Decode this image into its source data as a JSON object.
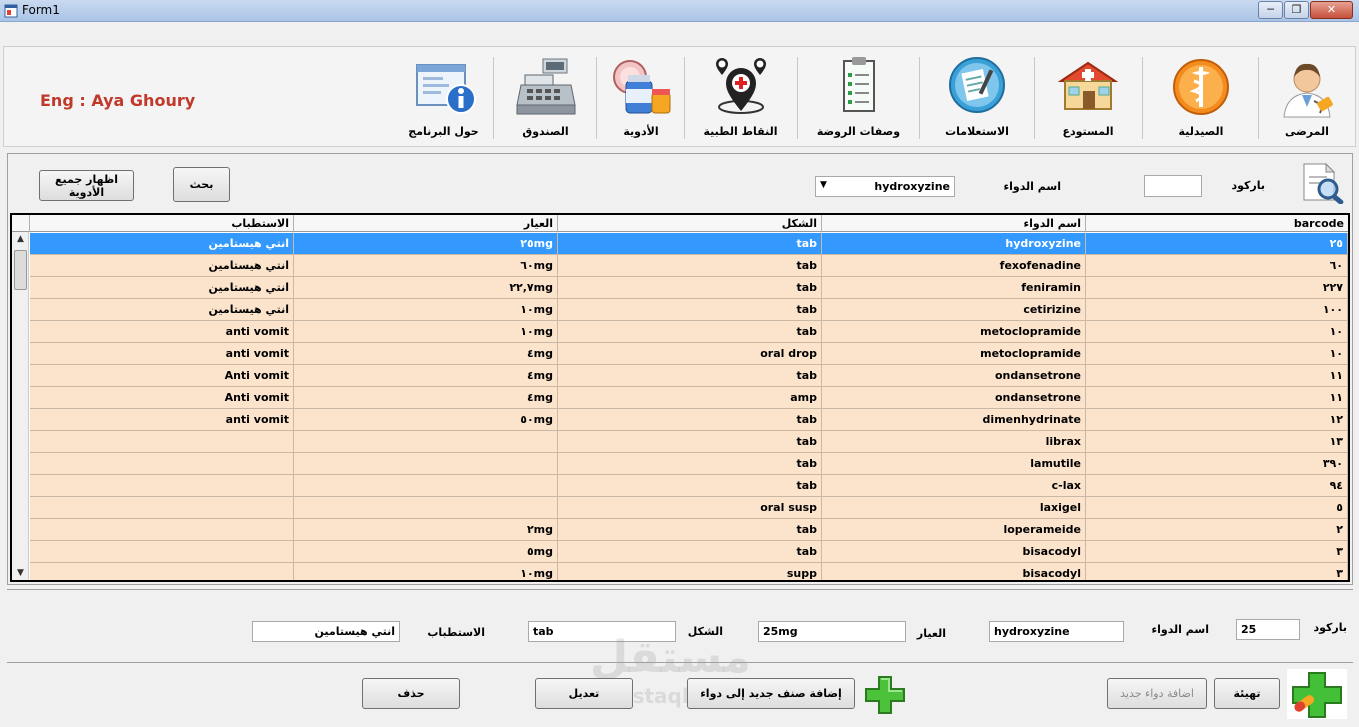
{
  "window": {
    "title": "Form1",
    "minimize": "─",
    "restore": "❐",
    "close": "✕"
  },
  "toolbar": {
    "author": "Eng : Aya Ghoury",
    "items": [
      {
        "label": "المرضى",
        "icon": "doctor-icon"
      },
      {
        "label": "الصيدلية",
        "icon": "pharmacy-caduceus-icon"
      },
      {
        "label": "المستودع",
        "icon": "warehouse-icon"
      },
      {
        "label": "الاستعلامات",
        "icon": "inquiries-icon"
      },
      {
        "label": "وصفات الروضة",
        "icon": "prescription-icon"
      },
      {
        "label": "النقاط الطبية",
        "icon": "medical-points-icon"
      },
      {
        "label": "الأدوية",
        "icon": "medicines-icon"
      },
      {
        "label": "الصندوق",
        "icon": "cash-register-icon"
      },
      {
        "label": "حول البرنامج",
        "icon": "about-info-icon"
      }
    ]
  },
  "search": {
    "barcode_label": "باركود",
    "barcode_value": "",
    "name_label": "اسم الدواء",
    "name_value": "hydroxyzine",
    "search_button": "بحث",
    "show_all_button": "اظهار جميع الأدوية"
  },
  "grid": {
    "columns": [
      "barcode",
      "اسم الدواء",
      "الشكل",
      "العيار",
      "الاستطباب"
    ],
    "rows": [
      [
        "٢٥",
        "hydroxyzine",
        "tab",
        "٢٥mg",
        "انتي هيستامين"
      ],
      [
        "٦٠",
        "fexofenadine",
        "tab",
        "٦٠mg",
        "انتي هيستامين"
      ],
      [
        "٢٢٧",
        "feniramin",
        "tab",
        "٢٢,٧mg",
        "انتي هيستامين"
      ],
      [
        "١٠٠",
        "cetirizine",
        "tab",
        "١٠mg",
        "انتي هيستامين"
      ],
      [
        "١٠",
        "metoclopramide",
        "tab",
        "١٠mg",
        "anti vomit"
      ],
      [
        "١٠",
        "metoclopramide",
        "oral drop",
        "٤mg",
        "anti vomit"
      ],
      [
        "١١",
        "ondansetrone",
        "tab",
        "٤mg",
        "Anti vomit"
      ],
      [
        "١١",
        "ondansetrone",
        "amp",
        "٤mg",
        "Anti vomit"
      ],
      [
        "١٢",
        "dimenhydrinate",
        "tab",
        "٥٠mg",
        "anti vomit"
      ],
      [
        "١٣",
        "librax",
        "tab",
        "",
        ""
      ],
      [
        "٣٩٠",
        "lamutile",
        "tab",
        "",
        ""
      ],
      [
        "٩٤",
        "c-lax",
        "tab",
        "",
        ""
      ],
      [
        "٥",
        "laxigel",
        "oral susp",
        "",
        ""
      ],
      [
        "٢",
        "loperameide",
        "tab",
        "٢mg",
        ""
      ],
      [
        "٣",
        "bisacodyl",
        "tab",
        "٥mg",
        ""
      ],
      [
        "٣",
        "bisacodyl",
        "supp",
        "١٠mg",
        ""
      ]
    ],
    "scroll_up": "▲",
    "scroll_down": "▼"
  },
  "detail": {
    "barcode_label": "باركود",
    "barcode_value": "25",
    "name_label": "اسم الدواء",
    "name_value": "hydroxyzine",
    "dose_label": "العيار",
    "dose_value": "25mg",
    "form_label": "الشكل",
    "form_value": "tab",
    "indication_label": "الاستطباب",
    "indication_value": "انتي هيستامين"
  },
  "actions": {
    "reset": "تهيئة",
    "add_new": "اضافة دواء جديد",
    "add_form": "إضافة صنف جديد إلى دواء",
    "edit": "تعديل",
    "delete": "حذف"
  },
  "watermark": {
    "text": "مستقل",
    "sub": "mostaql.com"
  },
  "colors": {
    "row_bg": "#fce4cc",
    "selected": "#3399ff",
    "author": "#c0392b"
  }
}
